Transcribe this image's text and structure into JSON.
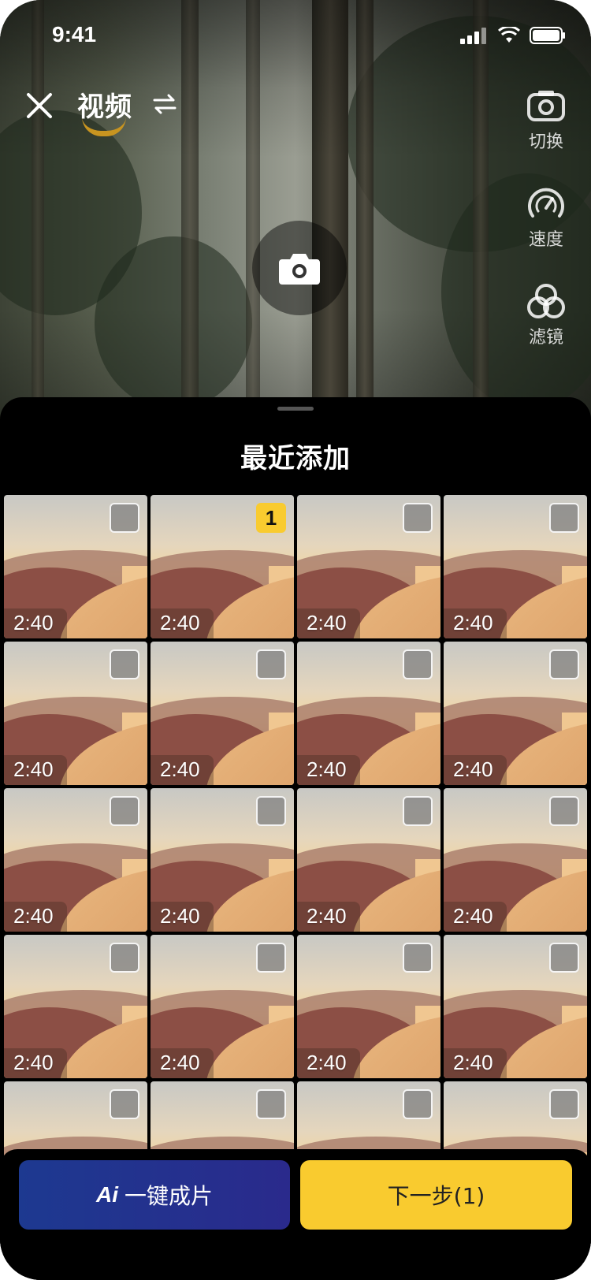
{
  "status_bar": {
    "time": "9:41"
  },
  "top_bar": {
    "mode_title": "视频"
  },
  "tools": [
    {
      "label": "切换",
      "icon": "flip-camera-icon"
    },
    {
      "label": "速度",
      "icon": "speed-icon"
    },
    {
      "label": "滤镜",
      "icon": "filter-icon"
    }
  ],
  "sheet": {
    "title": "最近添加",
    "items": [
      {
        "duration": "2:40",
        "selected_index": ""
      },
      {
        "duration": "2:40",
        "selected_index": "1"
      },
      {
        "duration": "2:40",
        "selected_index": ""
      },
      {
        "duration": "2:40",
        "selected_index": ""
      },
      {
        "duration": "2:40",
        "selected_index": ""
      },
      {
        "duration": "2:40",
        "selected_index": ""
      },
      {
        "duration": "2:40",
        "selected_index": ""
      },
      {
        "duration": "2:40",
        "selected_index": ""
      },
      {
        "duration": "2:40",
        "selected_index": ""
      },
      {
        "duration": "2:40",
        "selected_index": ""
      },
      {
        "duration": "2:40",
        "selected_index": ""
      },
      {
        "duration": "2:40",
        "selected_index": ""
      },
      {
        "duration": "2:40",
        "selected_index": ""
      },
      {
        "duration": "2:40",
        "selected_index": ""
      },
      {
        "duration": "2:40",
        "selected_index": ""
      },
      {
        "duration": "2:40",
        "selected_index": ""
      },
      {
        "duration": "",
        "selected_index": ""
      },
      {
        "duration": "",
        "selected_index": ""
      },
      {
        "duration": "",
        "selected_index": ""
      },
      {
        "duration": "",
        "selected_index": ""
      }
    ]
  },
  "actions": {
    "ai_logo": "Ai",
    "ai_label": "一键成片",
    "next_label": "下一步(1)"
  },
  "colors": {
    "accent_yellow": "#f9cb2f",
    "ai_button_blue": "#1d3990"
  }
}
